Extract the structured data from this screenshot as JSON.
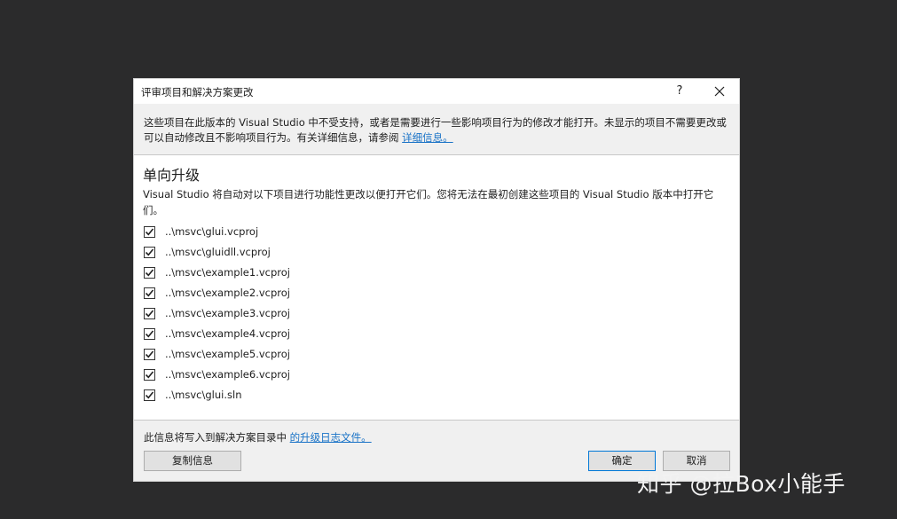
{
  "dialog": {
    "title": "评审项目和解决方案更改",
    "help_label": "?",
    "info": {
      "text": "这些项目在此版本的 Visual Studio 中不受支持，或者是需要进行一些影响项目行为的修改才能打开。未显示的项目不需要更改或可以自动修改且不影响项目行为。有关详细信息，请参阅 ",
      "link": "详细信息。"
    },
    "section": {
      "title": "单向升级",
      "description": "Visual Studio 将自动对以下项目进行功能性更改以便打开它们。您将无法在最初创建这些项目的 Visual Studio 版本中打开它们。"
    },
    "projects": [
      {
        "label": "..\\msvc\\glui.vcproj",
        "checked": true
      },
      {
        "label": "..\\msvc\\gluidll.vcproj",
        "checked": true
      },
      {
        "label": "..\\msvc\\example1.vcproj",
        "checked": true
      },
      {
        "label": "..\\msvc\\example2.vcproj",
        "checked": true
      },
      {
        "label": "..\\msvc\\example3.vcproj",
        "checked": true
      },
      {
        "label": "..\\msvc\\example4.vcproj",
        "checked": true
      },
      {
        "label": "..\\msvc\\example5.vcproj",
        "checked": true
      },
      {
        "label": "..\\msvc\\example6.vcproj",
        "checked": true
      },
      {
        "label": "..\\msvc\\glui.sln",
        "checked": true
      }
    ],
    "footer": {
      "text": "此信息将写入到解决方案目录中 ",
      "link": "的升级日志文件。"
    },
    "buttons": {
      "copy": "复制信息",
      "ok": "确定",
      "cancel": "取消"
    }
  },
  "watermark": "知乎 @拉Box小能手",
  "icons": {
    "close": "close-icon",
    "checkmark": "checkmark-icon"
  },
  "colors": {
    "link": "#1a73c7",
    "default_button_border": "#0078d7",
    "backdrop": "#2b2b2c"
  }
}
